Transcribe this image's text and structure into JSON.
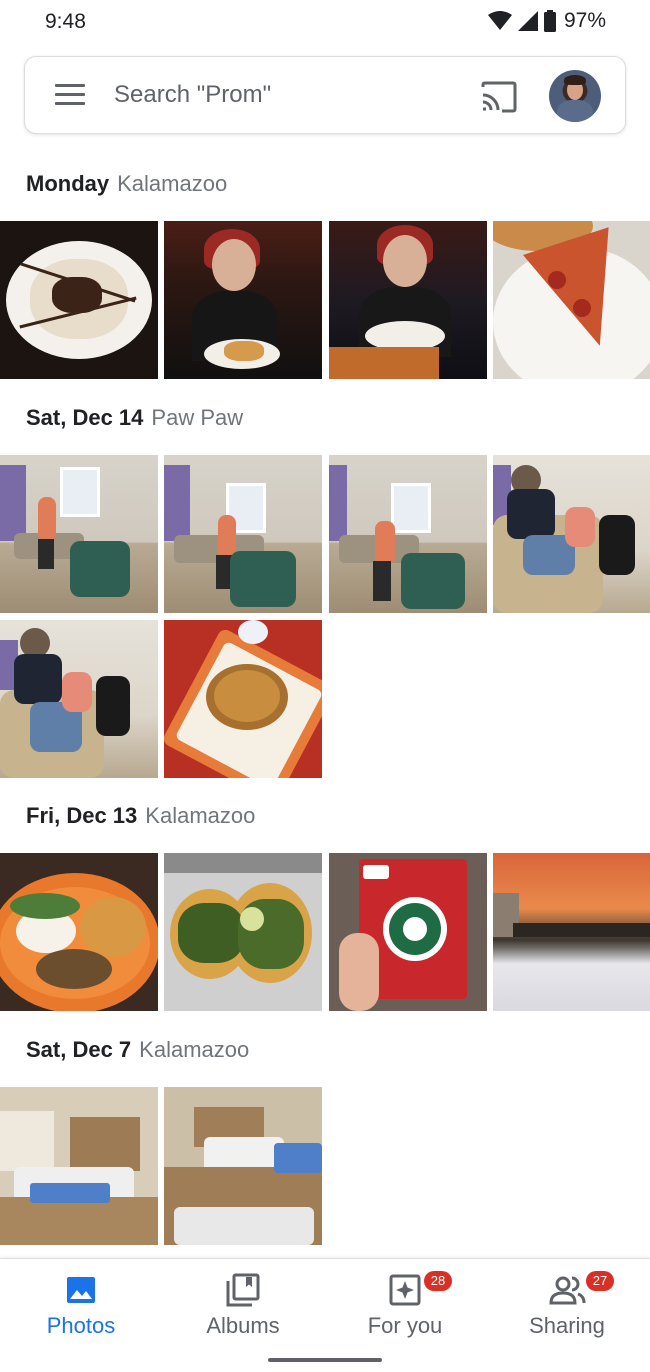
{
  "status_bar": {
    "time": "9:48",
    "battery": "97%"
  },
  "search": {
    "placeholder": "Search \"Prom\""
  },
  "sections": [
    {
      "date": "Monday",
      "location": "Kalamazoo",
      "photo_count": 4
    },
    {
      "date": "Sat, Dec 14",
      "location": "Paw Paw",
      "photo_count": 6
    },
    {
      "date": "Fri, Dec 13",
      "location": "Kalamazoo",
      "photo_count": 4
    },
    {
      "date": "Sat, Dec 7",
      "location": "Kalamazoo",
      "photo_count": 2
    }
  ],
  "bottom_nav": {
    "items": [
      {
        "label": "Photos",
        "icon": "photo-icon",
        "active": true
      },
      {
        "label": "Albums",
        "icon": "albums-icon",
        "active": false
      },
      {
        "label": "For you",
        "icon": "for-you-icon",
        "active": false,
        "badge": "28"
      },
      {
        "label": "Sharing",
        "icon": "sharing-icon",
        "active": false,
        "badge": "27"
      }
    ]
  },
  "colors": {
    "accent": "#1a73e8",
    "badge": "#d93025",
    "text_secondary": "#70757a"
  }
}
